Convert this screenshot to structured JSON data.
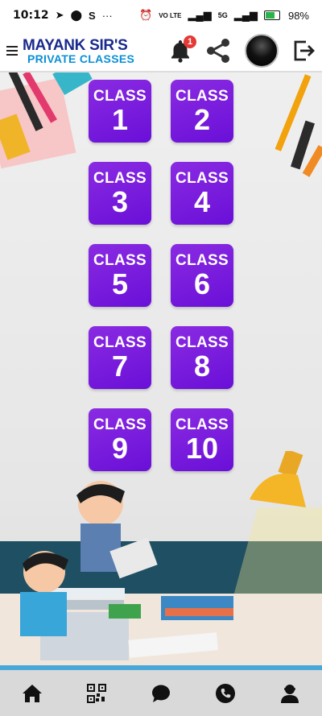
{
  "status_bar": {
    "time": "10:12",
    "extra_letter": "S",
    "dots": "···",
    "net_lte": "VO LTE",
    "net_5g": "5G",
    "battery_percent": "98%",
    "colors": {
      "battery": "#2bb34b"
    }
  },
  "header": {
    "brand_line1": "MAYANK SIR'S",
    "brand_line2": "PRIVATE CLASSES",
    "notification_count": "1",
    "icons": {
      "menu": "menu-icon",
      "bell": "bell-icon",
      "share": "share-icon",
      "avatar": "avatar",
      "logout": "logout-icon"
    }
  },
  "classes": {
    "word": "CLASS",
    "numbers": [
      "1",
      "2",
      "3",
      "4",
      "5",
      "6",
      "7",
      "8",
      "9",
      "10"
    ],
    "tile_color": "#7a1ee0"
  },
  "bottom_nav": {
    "items": [
      "home-icon",
      "qr-code-icon",
      "chat-icon",
      "phone-icon",
      "user-icon"
    ]
  }
}
